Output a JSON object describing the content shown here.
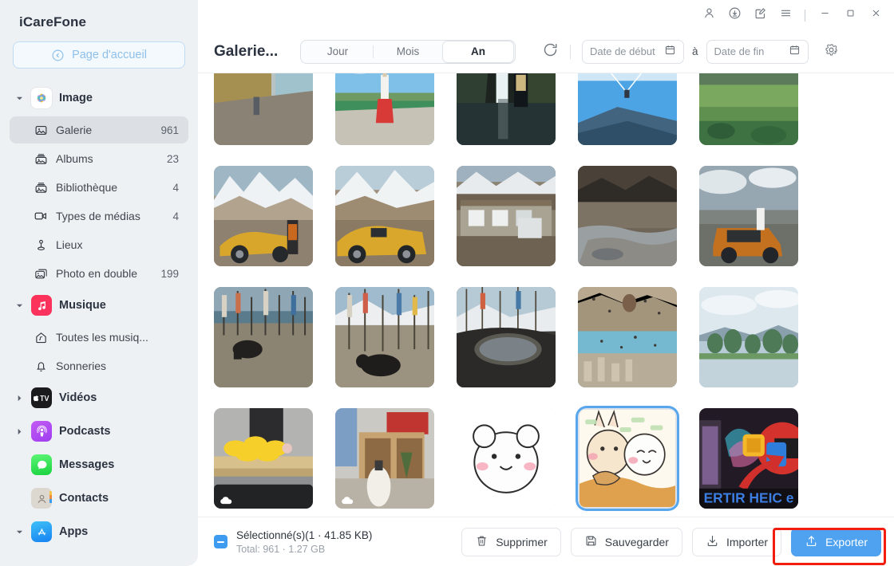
{
  "app": {
    "brand": "iCareFone"
  },
  "sidebar": {
    "home_button": {
      "label": "Page d'accueil",
      "icon": "back-circle-icon"
    },
    "groups": [
      {
        "id": "image",
        "label": "Image",
        "icon": "photos-app-icon",
        "expanded": true,
        "items": [
          {
            "id": "galerie",
            "label": "Galerie",
            "count": "961",
            "icon": "gallery-icon",
            "active": true
          },
          {
            "id": "albums",
            "label": "Albums",
            "count": "23",
            "icon": "albums-icon",
            "active": false
          },
          {
            "id": "bibliotheque",
            "label": "Bibliothèque",
            "count": "4",
            "icon": "library-icon",
            "active": false
          },
          {
            "id": "types-medias",
            "label": "Types de médias",
            "count": "4",
            "icon": "media-type-icon",
            "active": false
          },
          {
            "id": "lieux",
            "label": "Lieux",
            "count": "",
            "icon": "places-pin-icon",
            "active": false
          },
          {
            "id": "photo-double",
            "label": "Photo en double",
            "count": "199",
            "icon": "duplicate-icon",
            "active": false
          }
        ]
      },
      {
        "id": "musique",
        "label": "Musique",
        "icon": "music-app-icon",
        "expanded": true,
        "items": [
          {
            "id": "toutes-musiques",
            "label": "Toutes les musiq...",
            "count": "",
            "icon": "home-music-icon",
            "active": false
          },
          {
            "id": "sonneries",
            "label": "Sonneries",
            "count": "",
            "icon": "bell-icon",
            "active": false
          }
        ]
      },
      {
        "id": "videos",
        "label": "Vidéos",
        "icon": "appletv-app-icon",
        "expanded": false,
        "items": []
      },
      {
        "id": "podcasts",
        "label": "Podcasts",
        "icon": "podcasts-app-icon",
        "expanded": false,
        "items": []
      },
      {
        "id": "messages",
        "label": "Messages",
        "icon": "messages-app-icon",
        "expanded": null,
        "items": []
      },
      {
        "id": "contacts",
        "label": "Contacts",
        "icon": "contacts-app-icon",
        "expanded": null,
        "items": []
      },
      {
        "id": "apps",
        "label": "Apps",
        "icon": "appstore-app-icon",
        "expanded": true,
        "items": []
      }
    ]
  },
  "titlebar": {
    "buttons": [
      {
        "id": "account",
        "icon": "user-icon"
      },
      {
        "id": "downloads",
        "icon": "download-circle-icon"
      },
      {
        "id": "feedback",
        "icon": "feedback-note-icon"
      },
      {
        "id": "menu",
        "icon": "hamburger-menu-icon"
      }
    ],
    "window_buttons": [
      {
        "id": "minimize",
        "icon": "minimize-icon"
      },
      {
        "id": "maximize",
        "icon": "maximize-icon"
      },
      {
        "id": "close",
        "icon": "close-icon"
      }
    ]
  },
  "toolbar": {
    "title": "Galerie...",
    "view_tabs": [
      {
        "id": "jour",
        "label": "Jour",
        "active": false
      },
      {
        "id": "mois",
        "label": "Mois",
        "active": false
      },
      {
        "id": "an",
        "label": "An",
        "active": true
      }
    ],
    "refresh_icon": "refresh-icon",
    "date_start": {
      "placeholder": "Date de début",
      "value": "",
      "icon": "calendar-icon"
    },
    "date_join": "à",
    "date_end": {
      "placeholder": "Date de fin",
      "value": "",
      "icon": "calendar-icon"
    },
    "settings_icon": "gear-icon"
  },
  "gallery": {
    "columns": 5,
    "photos": [
      {
        "id": "p1",
        "alt": "lakeside-boats-person-walking",
        "selected": false,
        "cloud": false
      },
      {
        "id": "p2",
        "alt": "woman-red-skirt-on-road",
        "selected": false,
        "cloud": false
      },
      {
        "id": "p3",
        "alt": "waterfall-hiker-backpack",
        "selected": false,
        "cloud": false
      },
      {
        "id": "p4",
        "alt": "paraglider-red-canopy-sky",
        "selected": false,
        "cloud": false
      },
      {
        "id": "p5",
        "alt": "green-valley-lake-hills",
        "selected": false,
        "cloud": false
      },
      {
        "id": "p6",
        "alt": "gold-car-snow-mountain-man",
        "selected": false,
        "cloud": false
      },
      {
        "id": "p7",
        "alt": "gold-car-snow-mountain-window",
        "selected": false,
        "cloud": false
      },
      {
        "id": "p8",
        "alt": "tibetan-stone-house-truck",
        "selected": false,
        "cloud": false
      },
      {
        "id": "p9",
        "alt": "rocky-riverbed-dark-mountains",
        "selected": false,
        "cloud": false
      },
      {
        "id": "p10",
        "alt": "orange-suv-man-sitting-clouds",
        "selected": false,
        "cloud": false
      },
      {
        "id": "p11",
        "alt": "black-yak-prayer-flags-lake",
        "selected": false,
        "cloud": false
      },
      {
        "id": "p12",
        "alt": "black-dog-prayer-flags-peak",
        "selected": false,
        "cloud": false
      },
      {
        "id": "p13",
        "alt": "car-mirror-prayer-flags",
        "selected": false,
        "cloud": false
      },
      {
        "id": "p14",
        "alt": "hot-air-balloons-cappadocia",
        "selected": false,
        "cloud": false
      },
      {
        "id": "p15",
        "alt": "lake-trees-distant-mountains",
        "selected": false,
        "cloud": false
      },
      {
        "id": "p16",
        "alt": "yellow-rubber-ducks-desk",
        "selected": false,
        "cloud": true
      },
      {
        "id": "p17",
        "alt": "shelf-bottle-red-box-room",
        "selected": false,
        "cloud": true
      },
      {
        "id": "p18",
        "alt": "cartoon-white-bear-sticker",
        "selected": false,
        "cloud": false
      },
      {
        "id": "p19",
        "alt": "cartoon-rabbit-and-bear-eating",
        "selected": true,
        "cloud": false
      },
      {
        "id": "p20",
        "alt": "heic-to-jpg-convert-thumbnail",
        "selected": false,
        "cloud": false
      }
    ]
  },
  "bottombar": {
    "selection_label": "Sélectionné(s)(1 · 41.85 KB)",
    "total_label": "Total: 961 · 1.27 GB",
    "checkbox_state": "indeterminate",
    "actions": [
      {
        "id": "supprimer",
        "label": "Supprimer",
        "icon": "trash-icon",
        "primary": false
      },
      {
        "id": "sauvegarder",
        "label": "Sauvegarder",
        "icon": "save-disk-icon",
        "primary": false
      },
      {
        "id": "importer",
        "label": "Importer",
        "icon": "import-icon",
        "primary": false
      },
      {
        "id": "exporter",
        "label": "Exporter",
        "icon": "export-icon",
        "primary": true
      }
    ],
    "highlighted_action": "exporter"
  },
  "colors": {
    "accent": "#4ea2f0",
    "selection_border": "#58a7ee",
    "highlight": "#f11d0f",
    "sidebar_bg": "#eef1f4"
  }
}
